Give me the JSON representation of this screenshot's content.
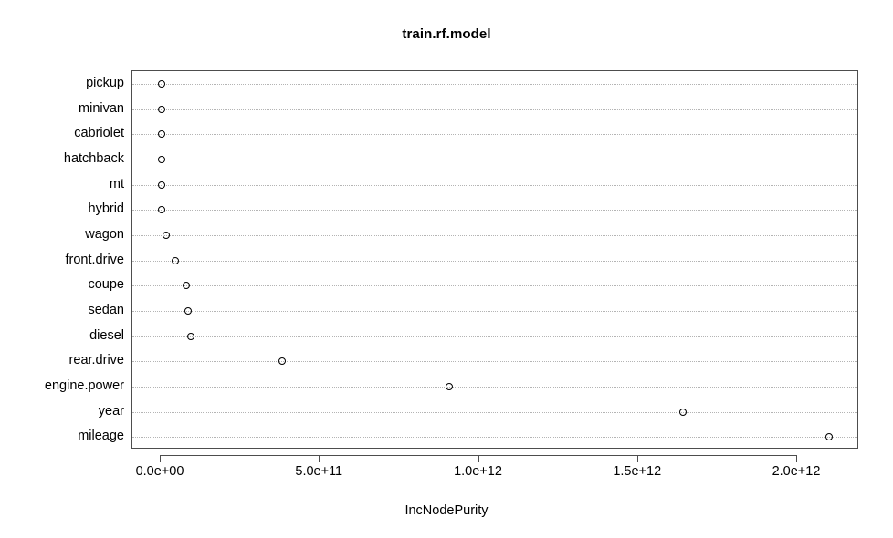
{
  "chart_data": {
    "type": "scatter",
    "title": "train.rf.model",
    "xlabel": "IncNodePurity",
    "ylabel": "",
    "grid": true,
    "legend": false,
    "xlim": [
      0,
      2160000000000.0
    ],
    "xticks": [
      0,
      500000000000,
      1000000000000,
      1500000000000,
      2000000000000
    ],
    "xticklabels": [
      "0.0e+00",
      "5.0e+11",
      "1.0e+12",
      "1.5e+12",
      "2.0e+12"
    ],
    "categories": [
      "mileage",
      "year",
      "engine.power",
      "rear.drive",
      "diesel",
      "sedan",
      "coupe",
      "front.drive",
      "wagon",
      "hybrid",
      "mt",
      "hatchback",
      "cabriolet",
      "minivan",
      "pickup"
    ],
    "values": [
      2100000000000.0,
      1640000000000.0,
      907000000000.0,
      382000000000.0,
      95000000000.0,
      86000000000.0,
      80000000000.0,
      46000000000.0,
      17000000000.0,
      3000000000.0,
      3000000000.0,
      3000000000.0,
      3000000000.0,
      3000000000.0,
      3000000000.0
    ],
    "point_style": "open-circle",
    "point_color": "#000000",
    "grid_color": "#b4b4b4",
    "frame_color": "#4d4d4d"
  }
}
